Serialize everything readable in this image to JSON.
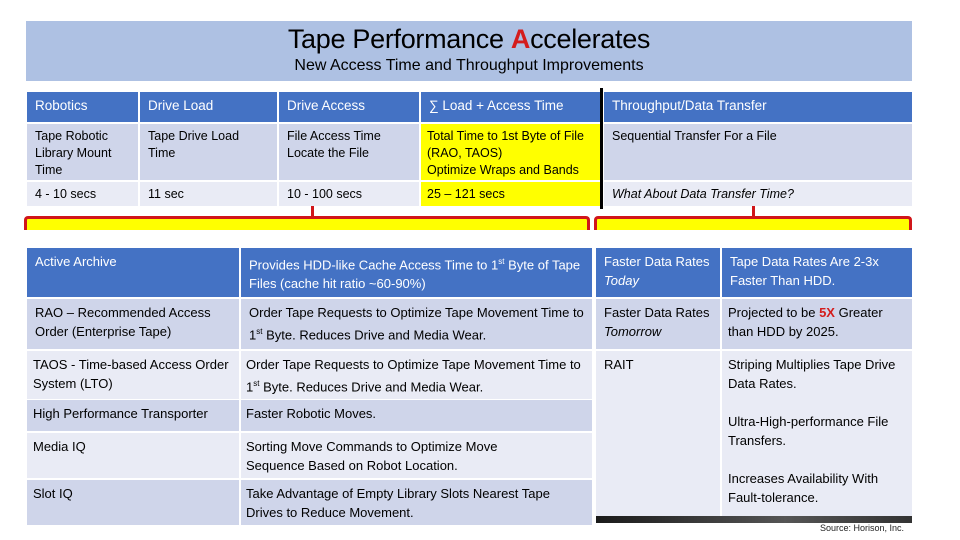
{
  "header": {
    "title_prefix": "Tape Performance ",
    "title_accent": "A",
    "title_suffix": "ccelerates",
    "subtitle": "New Access Time and Throughput Improvements"
  },
  "top_table": {
    "headers": [
      "Robotics",
      "Drive Load",
      "Drive Access",
      "∑ Load + Access Time",
      "Throughput/Data Transfer"
    ],
    "rows": [
      [
        "Tape Robotic Library Mount Time",
        "Tape Drive Load Time",
        "File Access Time Locate the File",
        "Total Time to 1st Byte of File (RAO, TAOS) Optimize Wraps and Bands",
        "Sequential Transfer For a File"
      ],
      [
        "4 - 10 secs",
        "11 sec",
        "10 - 100 secs",
        "25 – 121 secs",
        "What About Data Transfer Time?"
      ]
    ],
    "row1_col2_line1": "File Access Time",
    "row1_col2_line2": "Locate the File",
    "row1_col3_line1": "Total Time to 1st Byte of File",
    "row1_col3_line2": "(RAO, TAOS)",
    "row1_col3_line3": "Optimize Wraps and Bands",
    "highlight_color": "#ffff00"
  },
  "access_table": {
    "rows": [
      {
        "name": "Active Archive",
        "desc_pre": "Provides HDD-like Cache Access Time to 1",
        "desc_sup": "st",
        "desc_post": " Byte of Tape Files (cache hit ratio ~60-90%)"
      },
      {
        "name": "RAO – Recommended Access Order (Enterprise Tape)",
        "desc_pre": "Order Tape Requests to Optimize Tape Movement Time to 1",
        "desc_sup": "st",
        "desc_post": " Byte. Reduces Drive and Media Wear."
      },
      {
        "name": "TAOS - Time-based Access Order System (LTO)",
        "desc_pre": "Order Tape Requests to Optimize Tape Movement Time to 1",
        "desc_sup": "st",
        "desc_post": " Byte. Reduces Drive and Media Wear."
      },
      {
        "name": "High Performance Transporter",
        "desc": "Faster Robotic Moves."
      },
      {
        "name": "Media IQ",
        "desc": "Sorting Move Commands to Optimize Move Sequence Based on Robot Location."
      },
      {
        "name": "Slot IQ",
        "desc": "Take Advantage of Empty Library Slots Nearest Tape Drives to Reduce Movement."
      }
    ]
  },
  "throughput_table": {
    "rows": [
      {
        "name_pre": "Faster Data Rates ",
        "name_ital": "Today",
        "desc": "Tape Data Rates Are 2-3x Faster Than HDD."
      },
      {
        "name_pre": "Faster Data Rates ",
        "name_ital": "Tomorrow",
        "desc_pre": "Projected to be ",
        "desc_red": "5X",
        "desc_post": " Greater than HDD by 2025."
      },
      {
        "name": "RAIT",
        "desc_1": "Striping Multiplies Tape Drive Data Rates.",
        "desc_2": "Ultra-High-performance File Transfers.",
        "desc_3": "Increases Availability With Fault-tolerance."
      }
    ]
  },
  "source": "Source: Horison, Inc.",
  "colors": {
    "header_blue": "#4472c4",
    "banner_blue": "#aec1e3",
    "accent_red": "#d41c1c",
    "bracket_red": "#d0161a",
    "row_dark": "#cfd5ea",
    "row_light": "#e9ebf5"
  }
}
